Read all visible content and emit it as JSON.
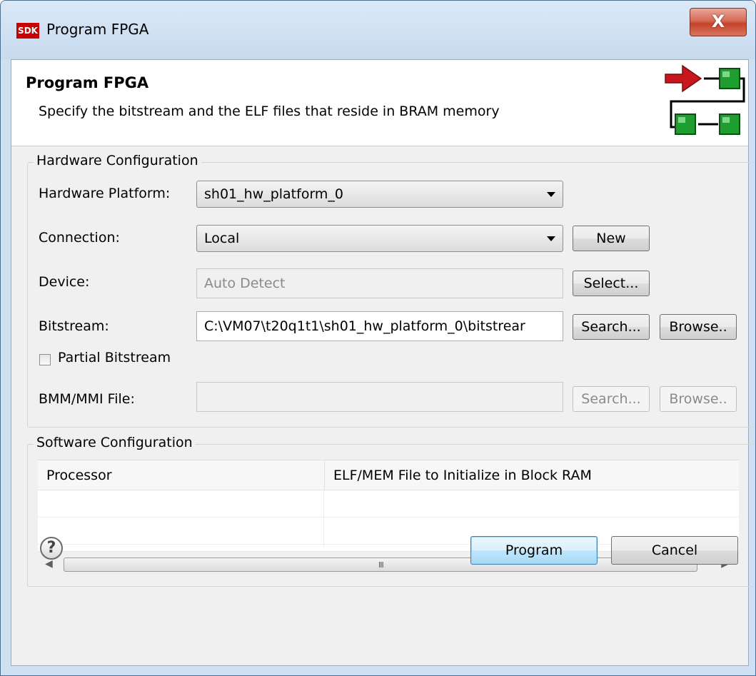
{
  "window": {
    "title": "Program FPGA",
    "app_icon_text": "SDK",
    "close_label": "X"
  },
  "banner": {
    "title": "Program FPGA",
    "description": "Specify the bitstream and the ELF files that reside in BRAM memory",
    "logo_icon": "program-flow-icon"
  },
  "hardware": {
    "legend": "Hardware Configuration",
    "platform_label": "Hardware Platform:",
    "platform_value": "sh01_hw_platform_0",
    "connection_label": "Connection:",
    "connection_value": "Local",
    "new_button": "New",
    "device_label": "Device:",
    "device_value": "Auto Detect",
    "select_button": "Select...",
    "bitstream_label": "Bitstream:",
    "bitstream_value": "C:\\VM07\\t20q1t1\\sh01_hw_platform_0\\bitstrear",
    "search_button": "Search...",
    "browse_button": "Browse..",
    "partial_label": "Partial Bitstream",
    "partial_checked": false,
    "bmm_label": "BMM/MMI File:",
    "bmm_value": "",
    "bmm_search_button": "Search...",
    "bmm_browse_button": "Browse.."
  },
  "software": {
    "legend": "Software Configuration",
    "columns": [
      "Processor",
      "ELF/MEM File to Initialize in Block RAM"
    ],
    "scroll_grip": "III"
  },
  "footer": {
    "program_button": "Program",
    "cancel_button": "Cancel",
    "help_symbol": "?"
  },
  "colors": {
    "arrow_red": "#c8161e",
    "block_green": "#1f9e2f",
    "window_frame": "#cfe0f1",
    "close_red": "#c4432b"
  }
}
